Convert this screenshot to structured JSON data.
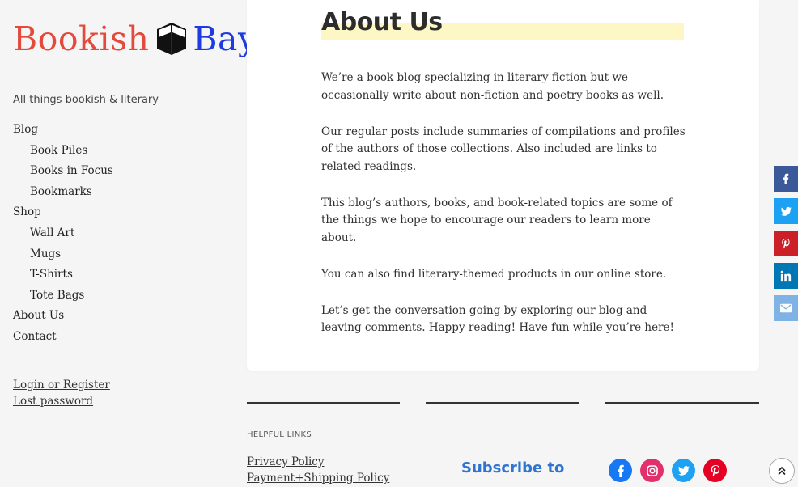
{
  "site": {
    "logo_word1": "Bookish",
    "logo_word2": "Bay",
    "tagline": "All things bookish & literary",
    "colors": {
      "logo_red": "#e34a3b",
      "logo_blue": "#1d3be0",
      "highlight": "#fdf7c5"
    }
  },
  "nav": [
    {
      "label": "Blog",
      "level": 0
    },
    {
      "label": "Book Piles",
      "level": 1
    },
    {
      "label": "Books in Focus",
      "level": 1
    },
    {
      "label": "Bookmarks",
      "level": 1
    },
    {
      "label": "Shop",
      "level": 0
    },
    {
      "label": "Wall Art",
      "level": 1
    },
    {
      "label": "Mugs",
      "level": 1
    },
    {
      "label": "T-Shirts",
      "level": 1
    },
    {
      "label": "Tote Bags",
      "level": 1
    },
    {
      "label": "About Us",
      "level": 0,
      "current": true
    },
    {
      "label": "Contact",
      "level": 0
    }
  ],
  "account": {
    "login": "Login or Register",
    "lost_password": "Lost password"
  },
  "page": {
    "title": "About Us",
    "paragraphs": [
      "We’re a book blog specializing in literary fiction but we occasionally write about non-fiction and poetry books as well.",
      "Our regular posts include summaries of compilations and profiles of the authors of those collections. Also included are links to related readings.",
      "This blog’s authors, books, and book-related topics are some of the things we hope to encourage our readers to learn more about.",
      "You can also find literary-themed products in our online store.",
      "Let’s get the conversation going by exploring our blog and leaving comments. Happy reading! Have fun while you’re here!"
    ]
  },
  "footer": {
    "helpful_heading": "HELPFUL LINKS",
    "links": [
      "Privacy Policy",
      "Payment+Shipping Policy"
    ],
    "subscribe": "Subscribe to",
    "socials": [
      {
        "icon": "facebook-icon",
        "color": "#1877f2"
      },
      {
        "icon": "instagram-icon",
        "color": "#e1306c"
      },
      {
        "icon": "twitter-icon",
        "color": "#1da1f2"
      },
      {
        "icon": "pinterest-icon",
        "color": "#e60023"
      }
    ]
  },
  "share_bar": [
    {
      "icon": "facebook-icon",
      "glyph": "f",
      "color": "#3b5998"
    },
    {
      "icon": "twitter-icon",
      "glyph": "t",
      "color": "#1da1f2"
    },
    {
      "icon": "pinterest-icon",
      "glyph": "p",
      "color": "#cb2027"
    },
    {
      "icon": "linkedin-icon",
      "glyph": "in",
      "color": "#0077b5"
    },
    {
      "icon": "email-icon",
      "glyph": "✉",
      "color": "#7fb2e5"
    }
  ]
}
